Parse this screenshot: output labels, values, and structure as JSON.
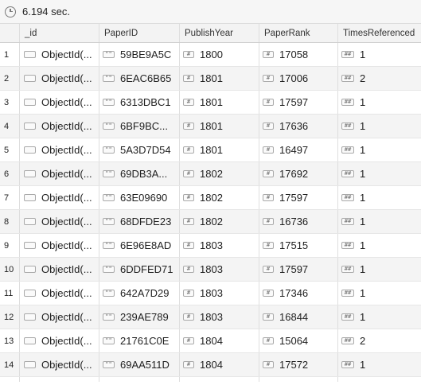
{
  "toolbar": {
    "timing": "6.194 sec."
  },
  "columns": [
    "",
    "_id",
    "PaperID",
    "PublishYear",
    "PaperRank",
    "TimesReferenced"
  ],
  "icons": {
    "id": "object-type-icon",
    "paper": "string-type-icon",
    "year": "integer-type-icon",
    "rank": "integer-type-icon",
    "times": "int32-type-icon"
  },
  "icon_glyphs": {
    "str": "\"\"",
    "int": "#",
    "i32": "##"
  },
  "rows": [
    {
      "n": "1",
      "id": "ObjectId(...",
      "paper": "59BE9A5C",
      "year": "1800",
      "rank": "17058",
      "times": "1"
    },
    {
      "n": "2",
      "id": "ObjectId(...",
      "paper": "6EAC6B65",
      "year": "1801",
      "rank": "17006",
      "times": "2"
    },
    {
      "n": "3",
      "id": "ObjectId(...",
      "paper": "6313DBC1",
      "year": "1801",
      "rank": "17597",
      "times": "1"
    },
    {
      "n": "4",
      "id": "ObjectId(...",
      "paper": "6BF9BC...",
      "year": "1801",
      "rank": "17636",
      "times": "1"
    },
    {
      "n": "5",
      "id": "ObjectId(...",
      "paper": "5A3D7D54",
      "year": "1801",
      "rank": "16497",
      "times": "1"
    },
    {
      "n": "6",
      "id": "ObjectId(...",
      "paper": "69DB3A...",
      "year": "1802",
      "rank": "17692",
      "times": "1"
    },
    {
      "n": "7",
      "id": "ObjectId(...",
      "paper": "63E09690",
      "year": "1802",
      "rank": "17597",
      "times": "1"
    },
    {
      "n": "8",
      "id": "ObjectId(...",
      "paper": "68DFDE23",
      "year": "1802",
      "rank": "16736",
      "times": "1"
    },
    {
      "n": "9",
      "id": "ObjectId(...",
      "paper": "6E96E8AD",
      "year": "1803",
      "rank": "17515",
      "times": "1"
    },
    {
      "n": "10",
      "id": "ObjectId(...",
      "paper": "6DDFED71",
      "year": "1803",
      "rank": "17597",
      "times": "1"
    },
    {
      "n": "11",
      "id": "ObjectId(...",
      "paper": "642A7D29",
      "year": "1803",
      "rank": "17346",
      "times": "1"
    },
    {
      "n": "12",
      "id": "ObjectId(...",
      "paper": "239AE789",
      "year": "1803",
      "rank": "16844",
      "times": "1"
    },
    {
      "n": "13",
      "id": "ObjectId(...",
      "paper": "21761C0E",
      "year": "1804",
      "rank": "15064",
      "times": "2"
    },
    {
      "n": "14",
      "id": "ObjectId(...",
      "paper": "69AA511D",
      "year": "1804",
      "rank": "17572",
      "times": "1"
    }
  ]
}
